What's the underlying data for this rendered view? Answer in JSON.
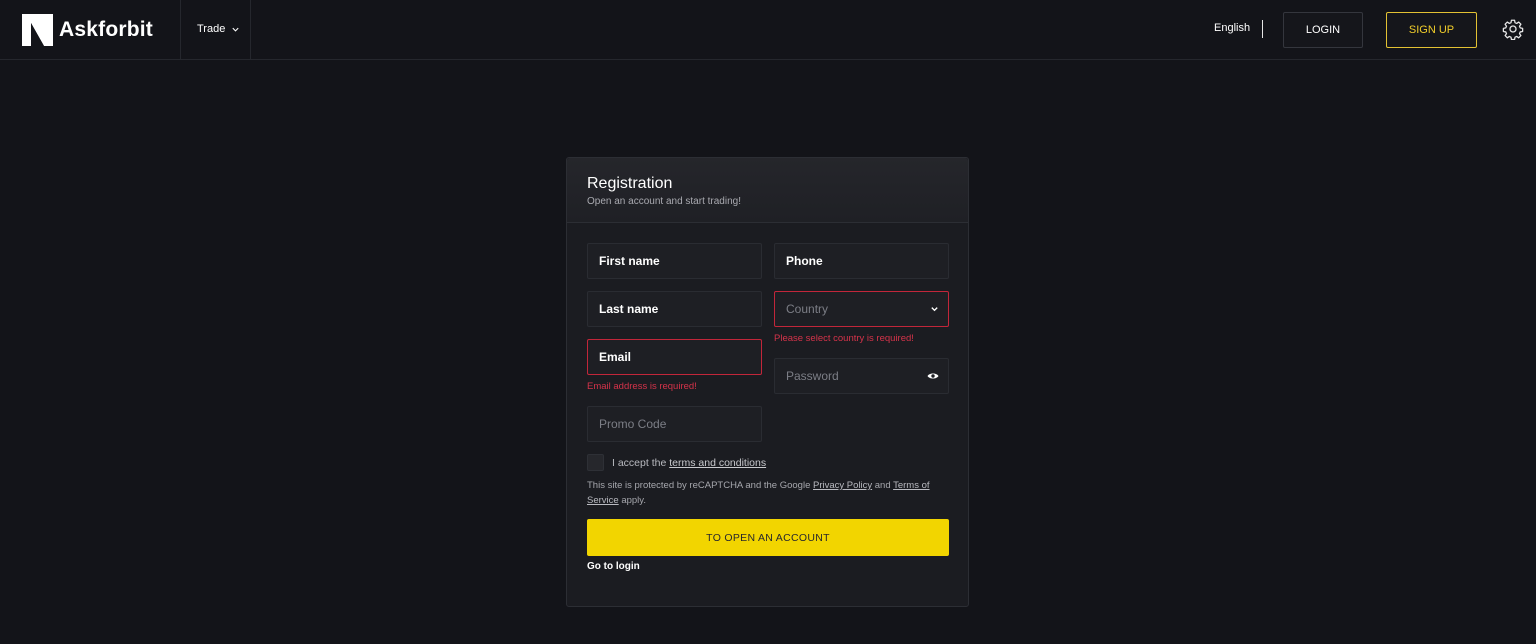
{
  "header": {
    "brand": "Askforbit",
    "trade_label": "Trade",
    "language": "English",
    "login_label": "LOGIN",
    "signup_label": "SIGN UP",
    "icons": {
      "logo": "askforbit-logo-icon",
      "trade_chevron": "chevron-down-icon",
      "settings": "gear-icon"
    }
  },
  "registration": {
    "title": "Registration",
    "subtitle": "Open an account and start trading!",
    "fields": {
      "first_name": {
        "label": "First name"
      },
      "phone": {
        "label": "Phone"
      },
      "last_name": {
        "label": "Last name"
      },
      "country": {
        "placeholder": "Country",
        "error": "Please select country is required!"
      },
      "email": {
        "label": "Email",
        "error": "Email address is required!"
      },
      "password": {
        "placeholder": "Password"
      },
      "promo_code": {
        "placeholder": "Promo Code"
      }
    },
    "terms": {
      "prefix": "I accept the",
      "link": "terms and conditions"
    },
    "recaptcha": {
      "text_before": "This site is protected by reCAPTCHA and the Google",
      "privacy_link": "Privacy Policy",
      "and": "and",
      "terms_link": "Terms of Service",
      "apply": "apply."
    },
    "submit_label": "TO OPEN AN ACCOUNT",
    "goto_login": "Go to login"
  },
  "colors": {
    "background": "#131419",
    "card": "#1b1c21",
    "accent_yellow": "#f2d500",
    "signup_border": "#e3c233",
    "error_red": "#d5334a"
  }
}
